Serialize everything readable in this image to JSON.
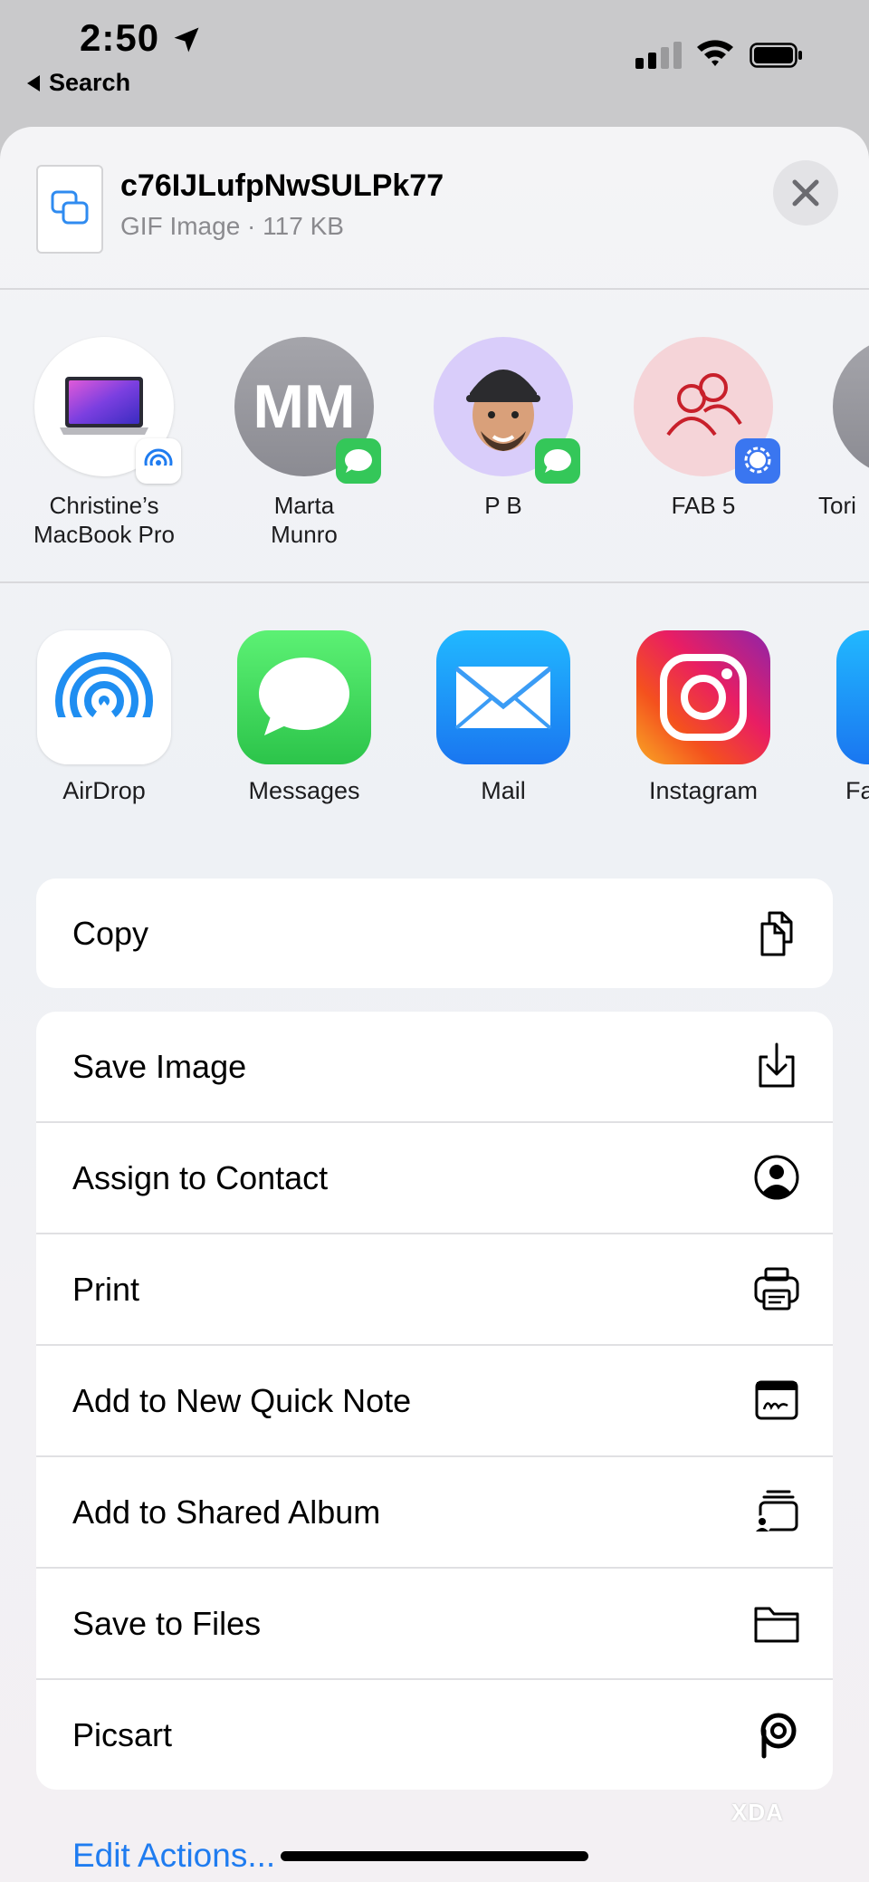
{
  "status_bar": {
    "time": "2:50",
    "back_label": "Search"
  },
  "file": {
    "name": "c76IJLufpNwSULPk77",
    "meta": "GIF Image · 117 KB"
  },
  "people": [
    {
      "name": "Christine’s MacBook Pro",
      "badge": "airdrop"
    },
    {
      "name": "Marta Munro",
      "initials": "MM",
      "badge": "messages"
    },
    {
      "name": "P B",
      "badge": "messages"
    },
    {
      "name": "FAB 5",
      "badge": "signal"
    },
    {
      "name": "Tori"
    }
  ],
  "apps": [
    {
      "label": "AirDrop"
    },
    {
      "label": "Messages"
    },
    {
      "label": "Mail"
    },
    {
      "label": "Instagram"
    },
    {
      "label": "Fa"
    }
  ],
  "actions_group1": [
    {
      "label": "Copy",
      "icon": "copy-icon"
    }
  ],
  "actions_group2": [
    {
      "label": "Save Image",
      "icon": "save-image-icon"
    },
    {
      "label": "Assign to Contact",
      "icon": "contact-icon"
    },
    {
      "label": "Print",
      "icon": "printer-icon"
    },
    {
      "label": "Add to New Quick Note",
      "icon": "quick-note-icon"
    },
    {
      "label": "Add to Shared Album",
      "icon": "shared-album-icon"
    },
    {
      "label": "Save to Files",
      "icon": "folder-icon"
    },
    {
      "label": "Picsart",
      "icon": "picsart-icon"
    }
  ],
  "edit_actions": "Edit Actions...",
  "watermark": "XDA",
  "colors": {
    "accent": "#1f7cf0",
    "messages_green": "#34c759",
    "signal_blue": "#3a76f0"
  }
}
